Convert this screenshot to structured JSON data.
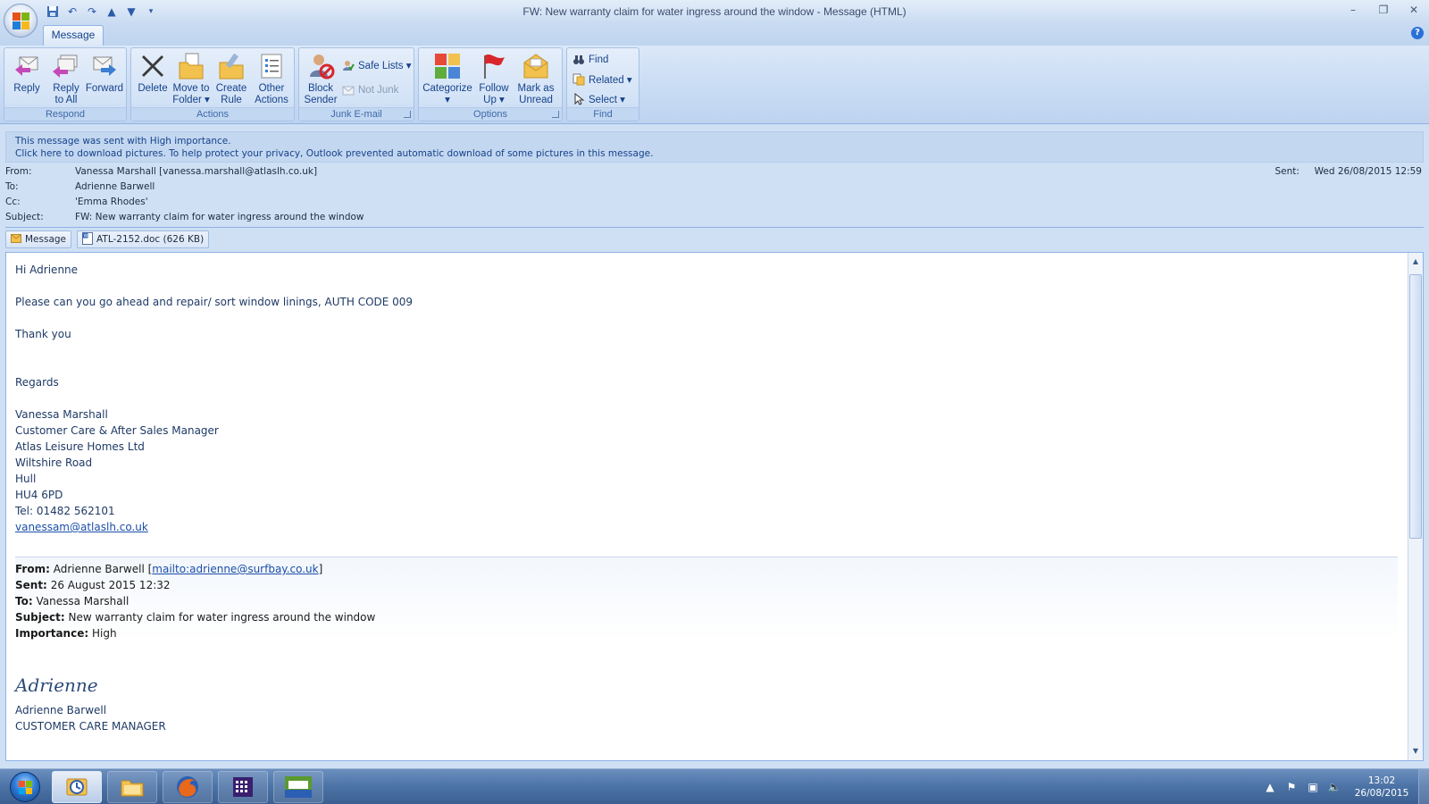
{
  "window": {
    "title": "FW: New warranty claim for water ingress around the window - Message (HTML)"
  },
  "tabs": [
    {
      "label": "Message"
    }
  ],
  "ribbon": {
    "groups": {
      "respond": "Respond",
      "actions": "Actions",
      "junk": "Junk E-mail",
      "options": "Options",
      "find": "Find"
    },
    "buttons": {
      "reply": [
        "Reply",
        ""
      ],
      "reply_all": [
        "Reply",
        "to All"
      ],
      "forward": [
        "Forward",
        ""
      ],
      "delete": [
        "Delete",
        ""
      ],
      "move": [
        "Move to",
        "Folder ▾"
      ],
      "create_rule": [
        "Create",
        "Rule"
      ],
      "other_actions": [
        "Other",
        "Actions ▾"
      ],
      "block_sender": [
        "Block",
        "Sender"
      ],
      "safe_lists": "Safe Lists ▾",
      "not_junk": "Not Junk",
      "categorize": [
        "Categorize",
        "▾"
      ],
      "follow_up": [
        "Follow",
        "Up ▾"
      ],
      "mark_unread": [
        "Mark as",
        "Unread"
      ],
      "find": "Find",
      "related": "Related ▾",
      "select": "Select ▾"
    }
  },
  "infobar": {
    "line1": "This message was sent with High importance.",
    "line2": "Click here to download pictures. To help protect your privacy, Outlook prevented automatic download of some pictures in this message."
  },
  "headers": {
    "from_label": "From:",
    "from": "Vanessa Marshall [vanessa.marshall@atlaslh.co.uk]",
    "to_label": "To:",
    "to": "Adrienne Barwell",
    "cc_label": "Cc:",
    "cc": "'Emma Rhodes'",
    "subject_label": "Subject:",
    "subject": "FW: New warranty claim for water ingress around the window",
    "sent_label": "Sent:",
    "sent": "Wed 26/08/2015 12:59"
  },
  "attachments": {
    "message_tab": "Message",
    "file": "ATL-2152.doc (626 KB)"
  },
  "body": {
    "greeting": "Hi Adrienne",
    "line1": "Please can you go ahead and repair/ sort window linings, AUTH CODE 009",
    "thanks": "Thank you",
    "regards": "Regards",
    "sig": [
      "Vanessa Marshall",
      "Customer Care & After Sales Manager",
      "Atlas Leisure Homes Ltd",
      "Wiltshire Road",
      "Hull",
      "HU4 6PD",
      "Tel: 01482 562101"
    ],
    "sig_email": "vanessam@atlaslh.co.uk",
    "fwd": {
      "from_label": "From:",
      "from_name": "Adrienne Barwell [",
      "from_link": "mailto:adrienne@surfbay.co.uk",
      "from_end": "]",
      "sent_label": "Sent:",
      "sent": "26 August 2015 12:32",
      "to_label": "To:",
      "to": "Vanessa Marshall",
      "subject_label": "Subject:",
      "subject": "New warranty claim for water ingress around the window",
      "importance_label": "Importance:",
      "importance": "High"
    },
    "signature_script": "Adrienne",
    "sender_name": "Adrienne Barwell",
    "sender_title": "CUSTOMER CARE MANAGER"
  },
  "taskbar": {
    "time": "13:02",
    "date": "26/08/2015"
  },
  "colors": {
    "accent": "#15428b",
    "ribbon": "#c7dbf3",
    "taskbar": "#4c73a6"
  }
}
